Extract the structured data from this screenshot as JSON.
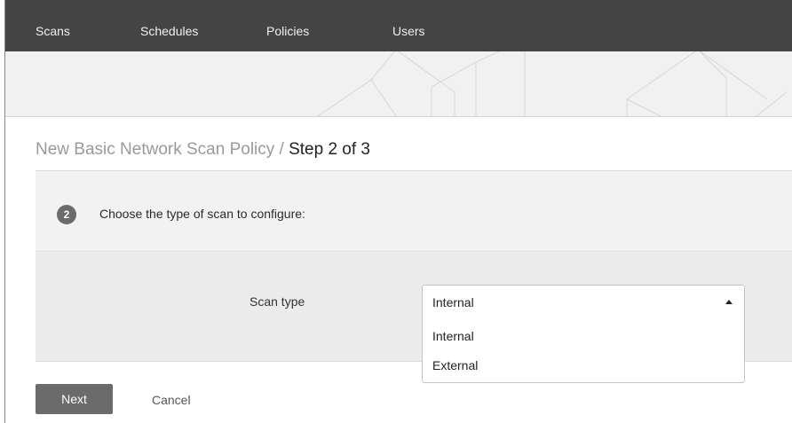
{
  "nav": {
    "items": [
      {
        "label": "Scans"
      },
      {
        "label": "Schedules"
      },
      {
        "label": "Policies"
      },
      {
        "label": "Users"
      }
    ]
  },
  "page": {
    "title_prefix": "New Basic Network Scan Policy / ",
    "title_step": "Step 2 of 3"
  },
  "step": {
    "number": "2",
    "instruction": "Choose the type of scan to configure:"
  },
  "form": {
    "scan_type_label": "Scan type",
    "scan_type_value": "Internal",
    "options": [
      "Internal",
      "External"
    ]
  },
  "actions": {
    "next_label": "Next",
    "cancel_label": "Cancel"
  },
  "colors": {
    "nav_bg": "#444444",
    "banner_bg": "#f1f1f1",
    "panel_bg": "#f2f2f2",
    "form_bg": "#ececec",
    "button_bg": "#6b6b6b"
  },
  "icons": {
    "dropdown_caret": "caret-up-icon"
  }
}
